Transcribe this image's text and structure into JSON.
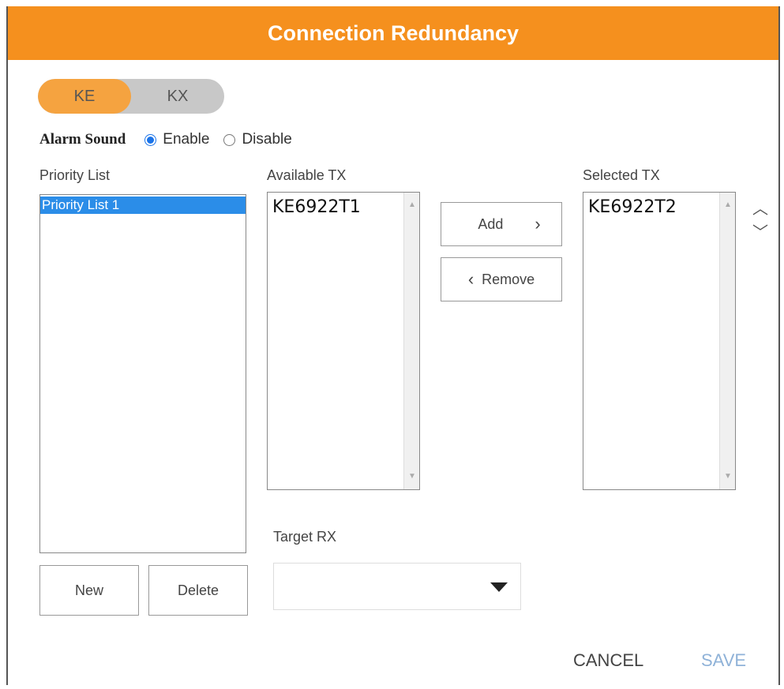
{
  "window": {
    "title": "Connection Redundancy"
  },
  "mode_toggle": {
    "options": [
      "KE",
      "KX"
    ],
    "selected": "KE"
  },
  "alarm_sound": {
    "label": "Alarm Sound",
    "enable": "Enable",
    "disable": "Disable",
    "selected": "Enable"
  },
  "priority_list": {
    "label": "Priority List",
    "items": [
      "Priority List 1"
    ],
    "new_label": "New",
    "delete_label": "Delete"
  },
  "available_tx": {
    "label": "Available TX",
    "items": [
      "KE6922T1"
    ]
  },
  "selected_tx": {
    "label": "Selected TX",
    "items": [
      "KE6922T2"
    ]
  },
  "transfer": {
    "add_label": "Add",
    "remove_label": "Remove"
  },
  "target_rx": {
    "label": "Target RX",
    "value": ""
  },
  "footer": {
    "cancel_label": "CANCEL",
    "save_label": "SAVE"
  },
  "colors": {
    "accent": "#f5901e",
    "selection": "#2b8de8",
    "save_disabled": "#8fb2d8"
  }
}
